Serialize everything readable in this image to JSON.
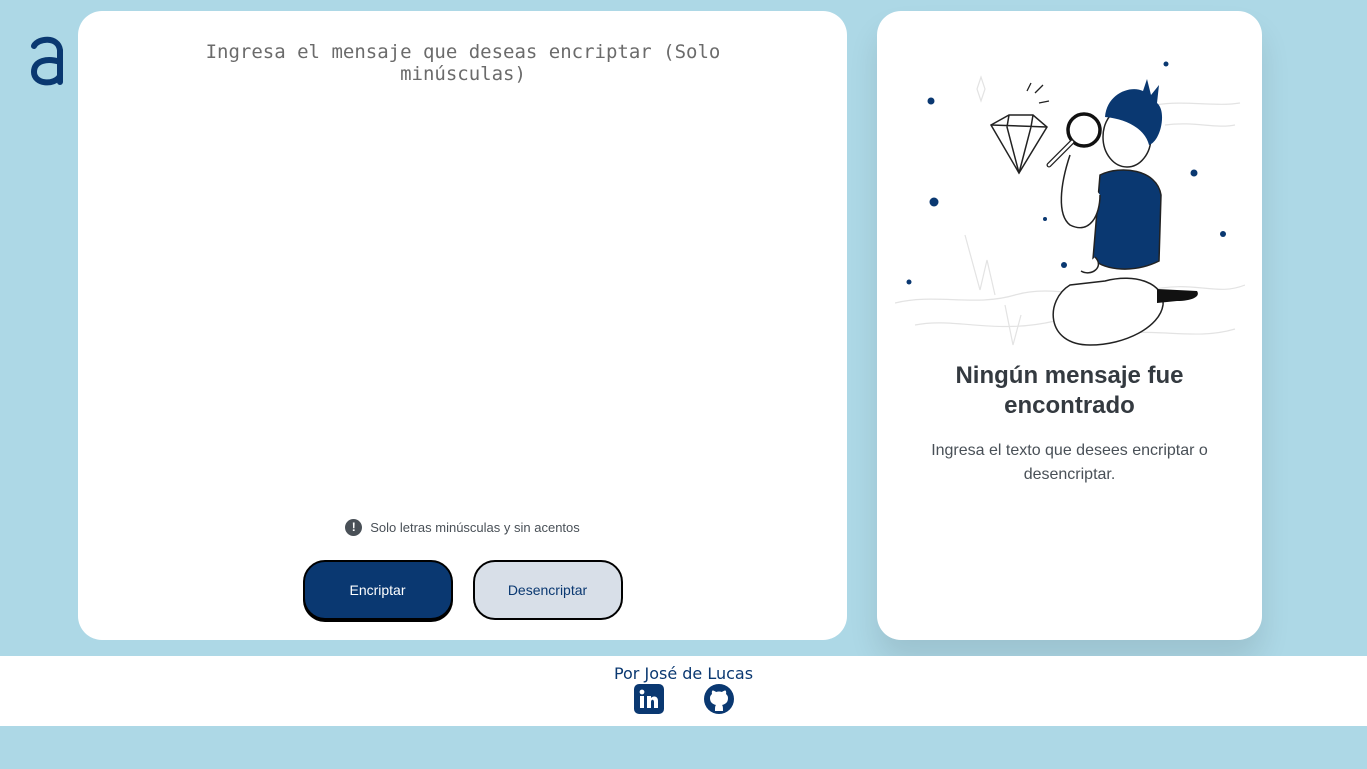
{
  "logo": {
    "icon": "alura-logo-icon",
    "color": "#0a3871"
  },
  "input": {
    "placeholder": "Ingresa el mensaje que deseas encriptar (Solo minúsculas)",
    "value": ""
  },
  "hint": {
    "icon": "exclamation-circle-icon",
    "text": "Solo letras minúsculas y sin acentos"
  },
  "buttons": {
    "encrypt_label": "Encriptar",
    "decrypt_label": "Desencriptar"
  },
  "output": {
    "illustration": "person-with-magnifying-glass-illustration",
    "title": "Ningún mensaje fue encontrado",
    "text": "Ingresa el texto que desees encriptar o desencriptar."
  },
  "footer": {
    "author": "Por José de Lucas",
    "links": [
      {
        "name": "linkedin-icon"
      },
      {
        "name": "github-icon"
      }
    ]
  },
  "colors": {
    "background": "#add8e6",
    "primary": "#0a3871",
    "card": "#ffffff",
    "secondary_button": "#d8dfe8"
  }
}
